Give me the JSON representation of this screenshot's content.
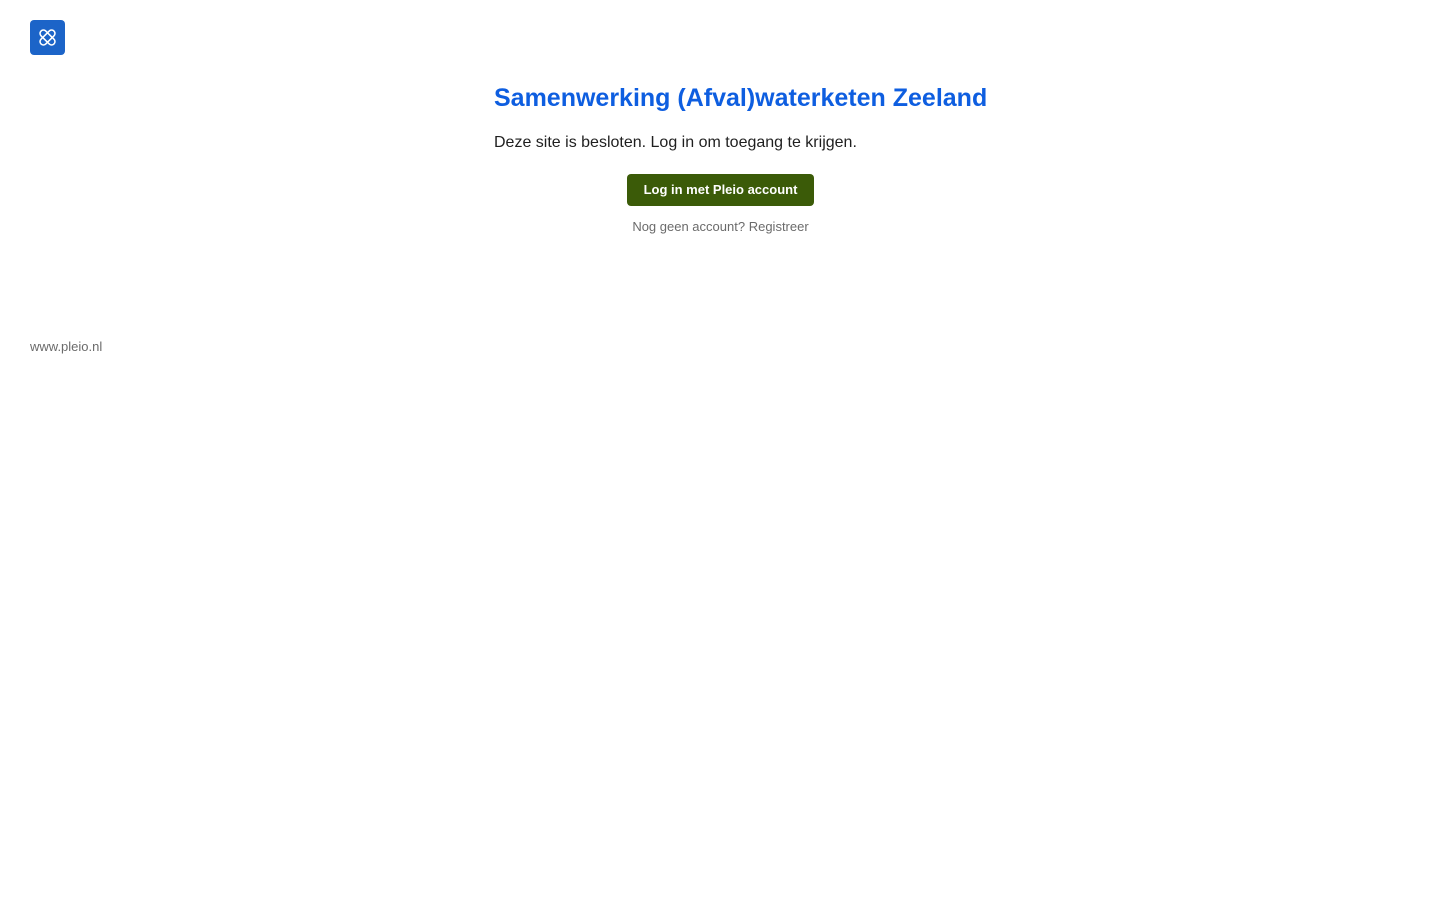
{
  "logo": {
    "icon": "pleio-logo-icon",
    "background_color": "#1c64c8"
  },
  "main": {
    "title": "Samenwerking (Afval)waterketen Zeeland",
    "message": "Deze site is besloten. Log in om toegang te krijgen."
  },
  "actions": {
    "login_label": "Log in met Pleio account",
    "no_account_text": "Nog geen account?",
    "register_label": "Registreer"
  },
  "footer": {
    "link_text": "www.pleio.nl"
  },
  "colors": {
    "title": "#0e5ee0",
    "button": "#3b5b08",
    "muted_text": "#6b6b6b"
  }
}
